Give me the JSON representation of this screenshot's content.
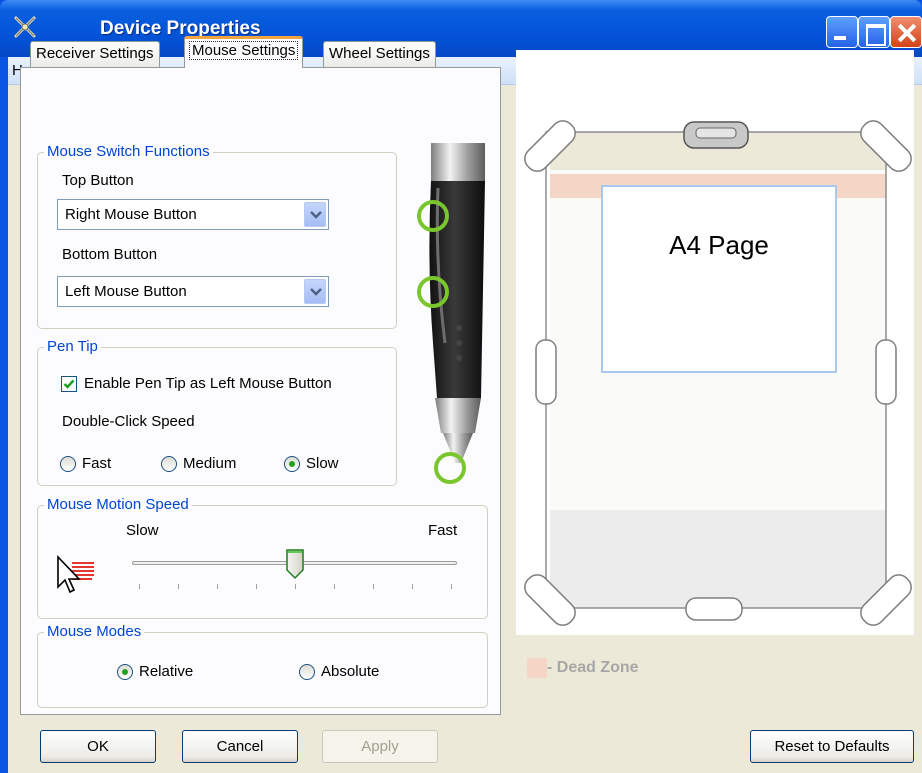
{
  "window": {
    "title": "Device Properties"
  },
  "menu": {
    "help": "Help"
  },
  "tabs": [
    "Receiver Settings",
    "Mouse Settings",
    "Wheel Settings"
  ],
  "mouse_switch": {
    "legend": "Mouse Switch Functions",
    "top_label": "Top Button",
    "top_value": "Right Mouse Button",
    "bottom_label": "Bottom Button",
    "bottom_value": "Left Mouse Button"
  },
  "pen_tip": {
    "legend": "Pen Tip",
    "enable_label": "Enable Pen Tip as Left Mouse Button",
    "enable_checked": true,
    "dbl_click_label": "Double-Click Speed",
    "speed_options": [
      "Fast",
      "Medium",
      "Slow"
    ],
    "speed_selected": "Slow"
  },
  "motion": {
    "legend": "Mouse Motion Speed",
    "slow": "Slow",
    "fast": "Fast",
    "level_fraction": 0.5
  },
  "modes": {
    "legend": "Mouse Modes",
    "options": [
      "Relative",
      "Absolute"
    ],
    "selected": "Relative"
  },
  "buttons": {
    "ok": "OK",
    "cancel": "Cancel",
    "apply": "Apply",
    "reset": "Reset to Defaults"
  },
  "preview": {
    "page_label": "A4 Page",
    "dead_zone": "- Dead Zone",
    "dead_zone_color": "#f3d6c6",
    "page_border_color": "#a9c8ec"
  },
  "colors": {
    "titlebar": "#0454d8",
    "group_legend": "#0046d5",
    "highlight_ring": "#7ac72d"
  }
}
